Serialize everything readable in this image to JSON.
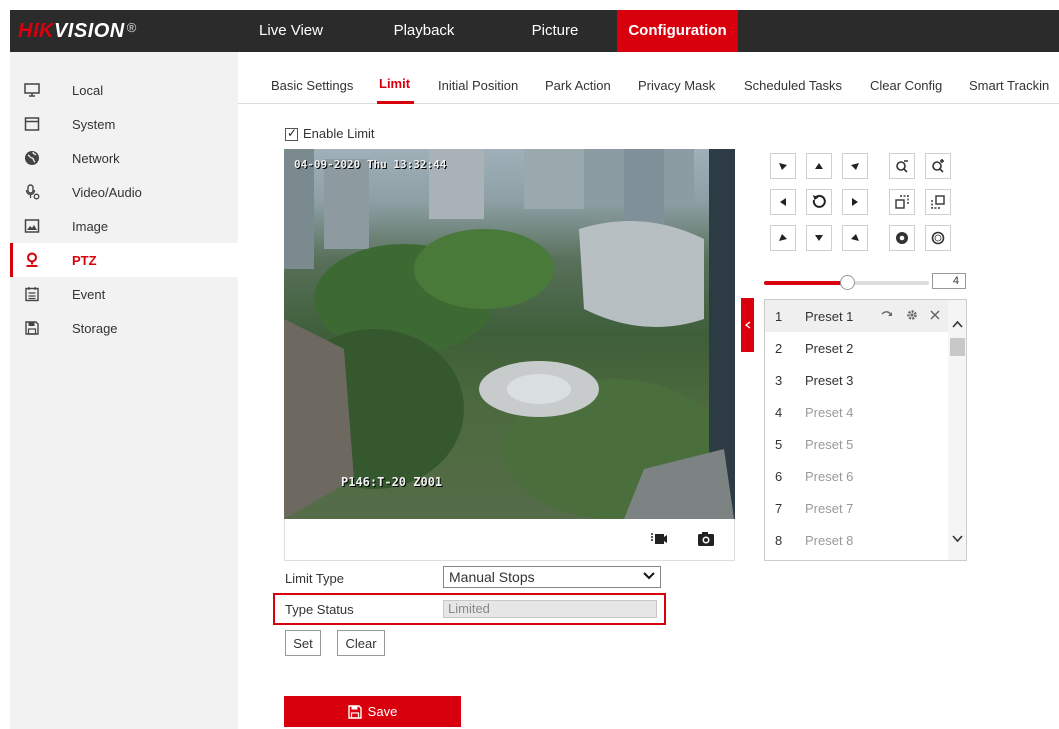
{
  "brand": {
    "logo_hik": "HIK",
    "logo_vision": "VISION",
    "logo_reg": "®"
  },
  "nav": [
    {
      "label": "Live View"
    },
    {
      "label": "Playback"
    },
    {
      "label": "Picture"
    },
    {
      "label": "Configuration"
    }
  ],
  "sidebar": {
    "items": [
      {
        "label": "Local",
        "icon": "monitor-icon"
      },
      {
        "label": "System",
        "icon": "window-icon"
      },
      {
        "label": "Network",
        "icon": "globe-icon"
      },
      {
        "label": "Video/Audio",
        "icon": "microphone-icon"
      },
      {
        "label": "Image",
        "icon": "image-icon"
      },
      {
        "label": "PTZ",
        "icon": "ptz-camera-icon"
      },
      {
        "label": "Event",
        "icon": "calendar-icon"
      },
      {
        "label": "Storage",
        "icon": "storage-icon"
      }
    ],
    "active": "PTZ"
  },
  "tabs": [
    {
      "label": "Basic Settings"
    },
    {
      "label": "Limit"
    },
    {
      "label": "Initial Position"
    },
    {
      "label": "Park Action"
    },
    {
      "label": "Privacy Mask"
    },
    {
      "label": "Scheduled Tasks"
    },
    {
      "label": "Clear Config"
    },
    {
      "label": "Smart Trackin"
    }
  ],
  "active_tab": "Limit",
  "limit": {
    "enable_label": "Enable Limit",
    "enabled": true
  },
  "video": {
    "osd_datetime": "04-09-2020 Thu 13:32:44",
    "osd_position": "P146:T-20 Z001"
  },
  "form": {
    "limit_type_label": "Limit Type",
    "limit_type_value": "Manual Stops",
    "type_status_label": "Type Status",
    "type_status_value": "Limited",
    "set_label": "Set",
    "clear_label": "Clear",
    "save_label": "Save"
  },
  "ptz": {
    "speed_value": "4",
    "speed_fraction": 0.5
  },
  "presets": [
    {
      "num": "1",
      "name": "Preset 1",
      "state": "set"
    },
    {
      "num": "2",
      "name": "Preset 2",
      "state": "set"
    },
    {
      "num": "3",
      "name": "Preset 3",
      "state": "set"
    },
    {
      "num": "4",
      "name": "Preset 4",
      "state": "unset"
    },
    {
      "num": "5",
      "name": "Preset 5",
      "state": "unset"
    },
    {
      "num": "6",
      "name": "Preset 6",
      "state": "unset"
    },
    {
      "num": "7",
      "name": "Preset 7",
      "state": "unset"
    },
    {
      "num": "8",
      "name": "Preset 8",
      "state": "unset"
    }
  ],
  "colors": {
    "accent": "#d9000d",
    "topbar": "#2b2b2b",
    "sidebar": "#f2f2f2"
  }
}
